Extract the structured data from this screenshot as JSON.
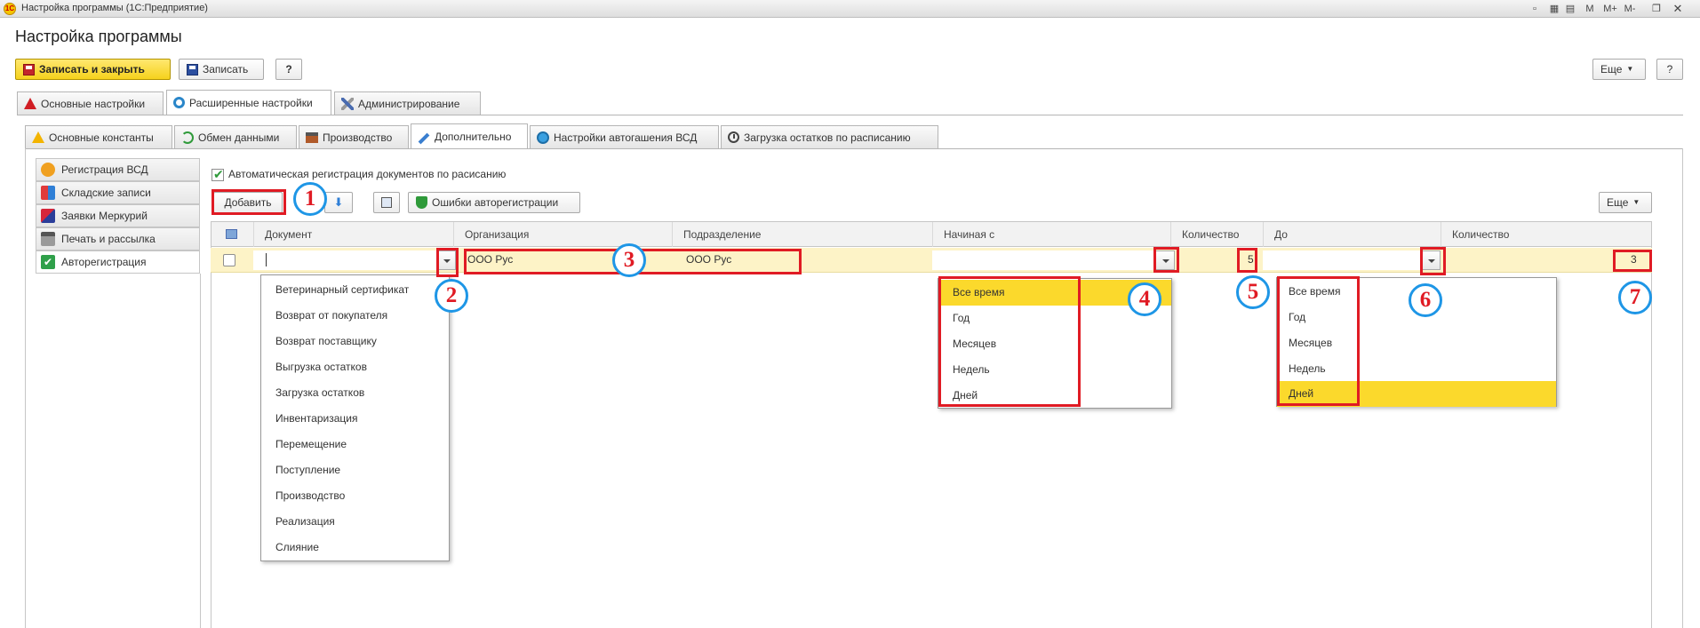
{
  "window": {
    "title": "Настройка программы  (1С:Предприятие)",
    "app_icon_text": "1С",
    "controls": [
      "M",
      "M+",
      "M-"
    ]
  },
  "form": {
    "title": "Настройка программы",
    "save_close_label": "Записать и закрыть",
    "save_label": "Записать",
    "help_label": "?",
    "more_label": "Еще"
  },
  "tabs_main": [
    {
      "label": "Основные настройки",
      "icon": "warning-red-icon"
    },
    {
      "label": "Расширенные настройки",
      "icon": "gear-icon",
      "active": true
    },
    {
      "label": "Администрирование",
      "icon": "tools-icon"
    }
  ],
  "tabs_sub": [
    {
      "label": "Основные константы",
      "icon": "warning-yellow-icon"
    },
    {
      "label": "Обмен данными",
      "icon": "exchange-icon"
    },
    {
      "label": "Производство",
      "icon": "factory-icon"
    },
    {
      "label": "Дополнительно",
      "icon": "pipette-icon",
      "active": true
    },
    {
      "label": "Настройки автогашения ВСД",
      "icon": "auto-icon"
    },
    {
      "label": "Загрузка остатков по расписанию",
      "icon": "clock-icon"
    }
  ],
  "sidebar": {
    "items": [
      {
        "label": "Регистрация ВСД",
        "icon": "certificate-icon"
      },
      {
        "label": "Складские записи",
        "icon": "blocks-icon"
      },
      {
        "label": "Заявки Меркурий",
        "icon": "cube-icon"
      },
      {
        "label": "Печать и рассылка",
        "icon": "printer-icon"
      },
      {
        "label": "Авторегистрация",
        "icon": "check-icon",
        "active": true
      }
    ]
  },
  "panel": {
    "auto_reg_checkbox_label": "Автоматическая регистрация документов по расисанию",
    "add_label": "Добавить",
    "errors_label": "Ошибки авторегистрации",
    "more_label": "Еще"
  },
  "table": {
    "columns": [
      "Документ",
      "Организация",
      "Подразделение",
      "Начиная с",
      "Количество",
      "До",
      "Количество"
    ],
    "row": {
      "document": "",
      "organization": "ООО Рус",
      "subdivision": "ООО Рус",
      "start_from": "",
      "count_from": "5",
      "until": "",
      "count_until": "3"
    }
  },
  "document_dropdown": [
    "Ветеринарный сертификат",
    "Возврат от покупателя",
    "Возврат поставщику",
    "Выгрузка остатков",
    "Загрузка остатков",
    "Инвентаризация",
    "Перемещение",
    "Поступление",
    "Производство",
    "Реализация",
    "Слияние"
  ],
  "start_dropdown": {
    "options": [
      "Все время",
      "Год",
      "Месяцев",
      "Недель",
      "Дней"
    ],
    "selected": "Все время"
  },
  "until_dropdown": {
    "options": [
      "Все время",
      "Год",
      "Месяцев",
      "Недель",
      "Дней"
    ],
    "selected": "Дней"
  },
  "annotations": [
    "1",
    "2",
    "3",
    "4",
    "5",
    "6",
    "7"
  ],
  "colors": {
    "highlight_row": "#fdf3c7",
    "selected_item": "#fbd92c",
    "annotation_box": "#e01b24",
    "annotation_circle": "#1e96e6"
  }
}
